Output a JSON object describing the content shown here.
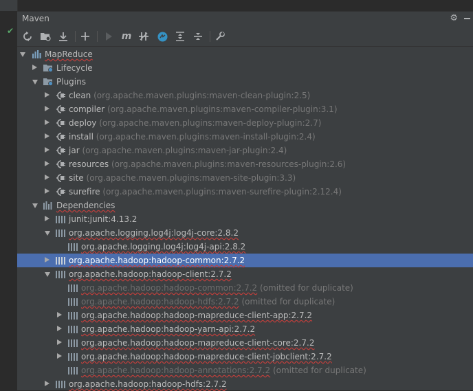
{
  "panel": {
    "title": "Maven"
  },
  "toolbar": {
    "buttons": [
      "reimport-icon",
      "generate-sources-icon",
      "download-icon",
      "add-icon",
      "run-icon",
      "m-icon",
      "skip-tests-icon",
      "offline-icon",
      "expand-all-icon",
      "collapse-all-icon",
      "settings-wrench-icon"
    ]
  },
  "tree": {
    "project": "MapReduce",
    "lifecycle": "Lifecycle",
    "plugins": "Plugins",
    "plugin_items": [
      {
        "name": "clean",
        "detail": "(org.apache.maven.plugins:maven-clean-plugin:2.5)"
      },
      {
        "name": "compiler",
        "detail": "(org.apache.maven.plugins:maven-compiler-plugin:3.1)"
      },
      {
        "name": "deploy",
        "detail": "(org.apache.maven.plugins:maven-deploy-plugin:2.7)"
      },
      {
        "name": "install",
        "detail": "(org.apache.maven.plugins:maven-install-plugin:2.4)"
      },
      {
        "name": "jar",
        "detail": "(org.apache.maven.plugins:maven-jar-plugin:2.4)"
      },
      {
        "name": "resources",
        "detail": "(org.apache.maven.plugins:maven-resources-plugin:2.6)"
      },
      {
        "name": "site",
        "detail": "(org.apache.maven.plugins:maven-site-plugin:3.3)"
      },
      {
        "name": "surefire",
        "detail": "(org.apache.maven.plugins:maven-surefire-plugin:2.12.4)"
      }
    ],
    "dependencies": "Dependencies",
    "deps": {
      "junit": "junit:junit:4.13.2",
      "log4j_core": "org.apache.logging.log4j:log4j-core:2.8.2",
      "log4j_api": "org.apache.logging.log4j:log4j-api:2.8.2",
      "hadoop_common": "org.apache.hadoop:hadoop-common:2.7.2",
      "hadoop_client": "org.apache.hadoop:hadoop-client:2.7.2",
      "hc_common": "org.apache.hadoop:hadoop-common:2.7.2",
      "hc_common_note": "(omitted for duplicate)",
      "hc_hdfs": "org.apache.hadoop:hadoop-hdfs:2.7.2",
      "hc_hdfs_note": "(omitted for duplicate)",
      "hc_mr_app": "org.apache.hadoop:hadoop-mapreduce-client-app:2.7.2",
      "hc_yarn_api": "org.apache.hadoop:hadoop-yarn-api:2.7.2",
      "hc_mr_core": "org.apache.hadoop:hadoop-mapreduce-client-core:2.7.2",
      "hc_mr_jobclient": "org.apache.hadoop:hadoop-mapreduce-client-jobclient:2.7.2",
      "hc_annotations": "org.apache.hadoop:hadoop-annotations:2.7.2",
      "hc_annotations_note": "(omitted for duplicate)",
      "hadoop_hdfs": "org.apache.hadoop:hadoop-hdfs:2.7.2"
    }
  },
  "colors": {
    "panel_bg": "#3c3f41",
    "selection": "#4b6eaf",
    "text": "#bbbbbb",
    "muted": "#787878",
    "error_underline": "#bc3f3c",
    "success": "#59a869"
  }
}
